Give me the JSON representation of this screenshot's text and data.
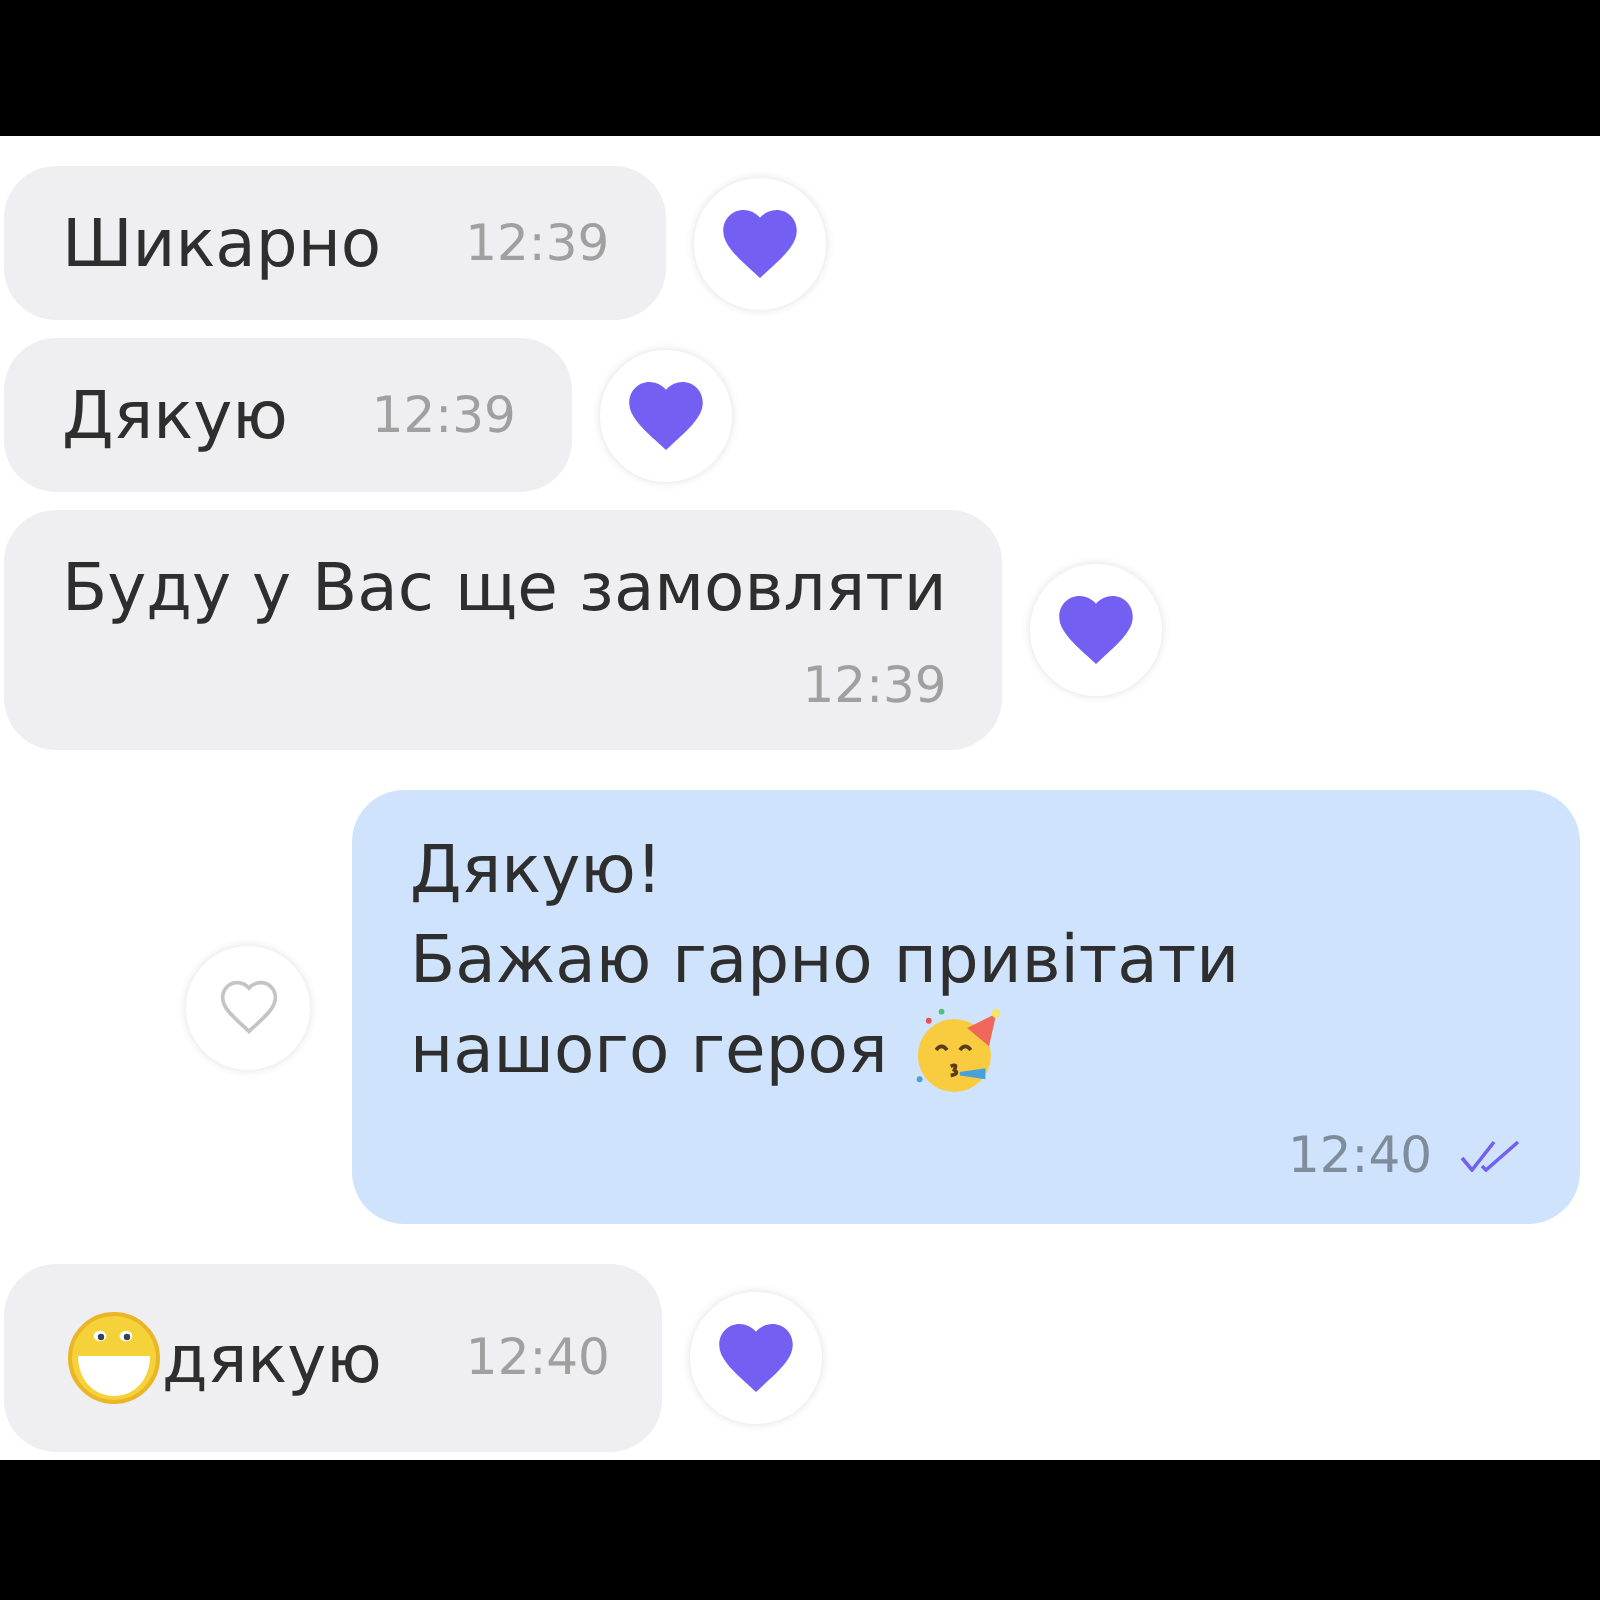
{
  "messages": [
    {
      "kind": "incoming",
      "lines": [
        "Шикарно"
      ],
      "time": "12:39",
      "time_below": false,
      "liked": true
    },
    {
      "kind": "incoming",
      "lines": [
        "Дякую"
      ],
      "time": "12:39",
      "time_below": false,
      "liked": true
    },
    {
      "kind": "incoming",
      "lines": [
        "Буду у Вас ще замовляти"
      ],
      "time": "12:39",
      "time_below": true,
      "liked": true
    },
    {
      "kind": "outgoing",
      "lines": [
        "Дякую!",
        "Бажаю гарно привітати",
        "нашого героя"
      ],
      "emoji": {
        "kind": "party",
        "at_end": true
      },
      "time": "12:40",
      "time_below": true,
      "read": true,
      "liked": false
    },
    {
      "kind": "incoming",
      "emoji": {
        "kind": "grin",
        "at_end": false
      },
      "lines": [
        "дякую"
      ],
      "time": "12:40",
      "time_below": false,
      "liked": true
    }
  ]
}
